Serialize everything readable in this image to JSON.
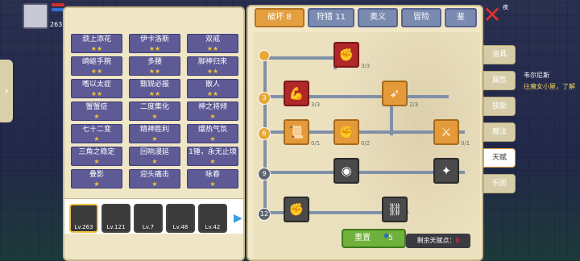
{
  "hud": {
    "level": "263",
    "hp_label": "HP",
    "mp_label": "MP"
  },
  "achievements": [
    {
      "name": "",
      "stars": "★★★"
    },
    {
      "name": "",
      "stars": "★★"
    },
    {
      "name": "",
      "stars": "★★★"
    },
    {
      "name": "颈上添花",
      "stars": "★★"
    },
    {
      "name": "伊卡洛斯",
      "stars": "★★"
    },
    {
      "name": "双戒",
      "stars": "★★"
    },
    {
      "name": "崎岖手腕",
      "stars": "★★"
    },
    {
      "name": "多腰",
      "stars": "★★"
    },
    {
      "name": "脚神归来",
      "stars": "★★"
    },
    {
      "name": "嗜以太症",
      "stars": "★★"
    },
    {
      "name": "甄锐必报",
      "stars": "★★"
    },
    {
      "name": "散人",
      "stars": "★★"
    },
    {
      "name": "蟹蟹症",
      "stars": "★"
    },
    {
      "name": "二度集化",
      "stars": "★"
    },
    {
      "name": "神之将倾",
      "stars": "★"
    },
    {
      "name": "七十二变",
      "stars": "★"
    },
    {
      "name": "精神胜利",
      "stars": "★"
    },
    {
      "name": "爆热气氛",
      "stars": "★"
    },
    {
      "name": "三角之稳定",
      "stars": "★"
    },
    {
      "name": "回响漫延",
      "stars": "★"
    },
    {
      "name": "1锤，永无止境",
      "stars": "★"
    },
    {
      "name": "叠影",
      "stars": "★"
    },
    {
      "name": "迎头痛击",
      "stars": "★"
    },
    {
      "name": "咏春",
      "stars": "★"
    }
  ],
  "avatars": [
    {
      "level": "Lv.263",
      "selected": true
    },
    {
      "level": "Lv.121",
      "selected": false
    },
    {
      "level": "Lv.7",
      "selected": false
    },
    {
      "level": "Lv.48",
      "selected": false
    },
    {
      "level": "Lv.42",
      "selected": false
    }
  ],
  "tabs": [
    "破坏 8",
    "狩猎 11",
    "奥义",
    "冒险",
    "鉴"
  ],
  "talent_levels": [
    "3",
    "6",
    "9",
    "12"
  ],
  "talent_nodes": [
    {
      "icon": "arm-wrestle-icon",
      "count": "3/3",
      "style": "red"
    },
    {
      "icon": "muscle-icon",
      "count": "3/3",
      "style": "red"
    },
    {
      "icon": "arrow-icon",
      "count": "2/3",
      "style": "orange"
    },
    {
      "icon": "scroll-icon",
      "count": "0/1",
      "style": "orange"
    },
    {
      "icon": "fist-icon",
      "count": "0/2",
      "style": "orange"
    },
    {
      "icon": "sword-icon",
      "count": "0/1",
      "style": "orange"
    },
    {
      "icon": "ripple-icon",
      "count": "",
      "style": "gray"
    },
    {
      "icon": "claw-icon",
      "count": "",
      "style": "gray"
    },
    {
      "icon": "punch-icon",
      "count": "",
      "style": "gray"
    },
    {
      "icon": "chain-icon",
      "count": "",
      "style": "gray"
    }
  ],
  "reset": {
    "label": "重置",
    "cost": "5",
    "remaining_label": "剩余天赋点：",
    "remaining_value": "0"
  },
  "side_tabs": [
    "道具",
    "属性",
    "技能",
    "魔法",
    "天赋",
    "乐团"
  ],
  "background": {
    "npc_name": "韦尔尼斯",
    "chat": "往魔女小屋，了解",
    "mini_label": "夜"
  }
}
